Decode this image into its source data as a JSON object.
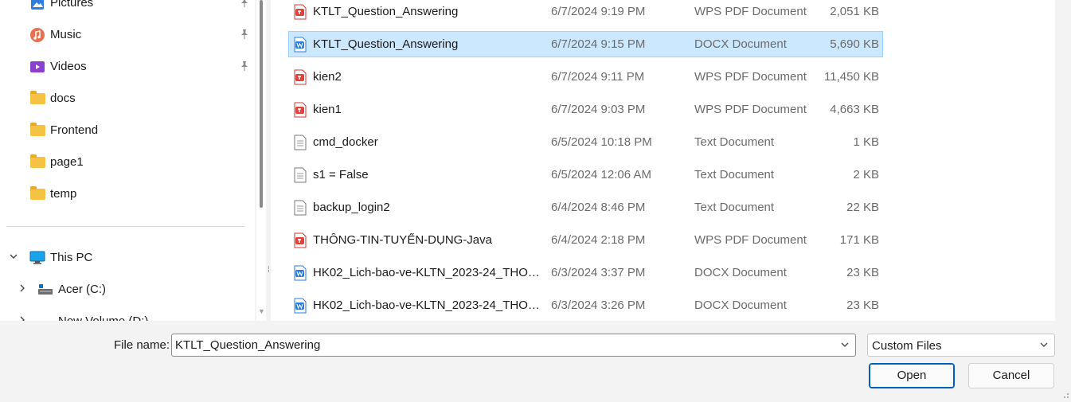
{
  "nav": {
    "quick_access": [
      {
        "label": "Pictures",
        "icon": "pictures-icon",
        "pinned": true
      },
      {
        "label": "Music",
        "icon": "music-icon",
        "pinned": true
      },
      {
        "label": "Videos",
        "icon": "videos-icon",
        "pinned": true
      },
      {
        "label": "docs",
        "icon": "folder-icon",
        "pinned": false
      },
      {
        "label": "Frontend",
        "icon": "folder-icon",
        "pinned": false
      },
      {
        "label": "page1",
        "icon": "folder-icon",
        "pinned": false
      },
      {
        "label": "temp",
        "icon": "folder-icon",
        "pinned": false
      }
    ],
    "this_pc": {
      "label": "This PC",
      "expanded": true
    },
    "drives": [
      {
        "label": "Acer (C:)"
      },
      {
        "label": "New Volume (D:)"
      }
    ]
  },
  "files": [
    {
      "name": "KTLT_Question_Answering",
      "date": "6/7/2024 9:19 PM",
      "type": "WPS PDF Document",
      "size": "2,051 KB",
      "kind": "pdf",
      "selected": false
    },
    {
      "name": "KTLT_Question_Answering",
      "date": "6/7/2024 9:15 PM",
      "type": "DOCX Document",
      "size": "5,690 KB",
      "kind": "docx",
      "selected": true
    },
    {
      "name": "kien2",
      "date": "6/7/2024 9:11 PM",
      "type": "WPS PDF Document",
      "size": "11,450 KB",
      "kind": "pdf",
      "selected": false
    },
    {
      "name": "kien1",
      "date": "6/7/2024 9:03 PM",
      "type": "WPS PDF Document",
      "size": "4,663 KB",
      "kind": "pdf",
      "selected": false
    },
    {
      "name": "cmd_docker",
      "date": "6/5/2024 10:18 PM",
      "type": "Text Document",
      "size": "1 KB",
      "kind": "txt",
      "selected": false
    },
    {
      "name": "s1 = False",
      "date": "6/5/2024 12:06 AM",
      "type": "Text Document",
      "size": "2 KB",
      "kind": "txt",
      "selected": false
    },
    {
      "name": "backup_login2",
      "date": "6/4/2024 8:46 PM",
      "type": "Text Document",
      "size": "22 KB",
      "kind": "txt",
      "selected": false
    },
    {
      "name": "THÔNG-TIN-TUYỂN-DỤNG-Java",
      "date": "6/4/2024 2:18 PM",
      "type": "WPS PDF Document",
      "size": "171 KB",
      "kind": "pdf",
      "selected": false
    },
    {
      "name": "HK02_Lich-bao-ve-KLTN_2023-24_THON...",
      "date": "6/3/2024 3:37 PM",
      "type": "DOCX Document",
      "size": "23 KB",
      "kind": "docx",
      "selected": false
    },
    {
      "name": "HK02_Lich-bao-ve-KLTN_2023-24_THON...",
      "date": "6/3/2024 3:26 PM",
      "type": "DOCX Document",
      "size": "23 KB",
      "kind": "docx",
      "selected": false
    }
  ],
  "footer": {
    "filename_label": "File name:",
    "filename_value": "KTLT_Question_Answering",
    "filetype_value": "Custom Files",
    "open_label": "Open",
    "cancel_label": "Cancel"
  },
  "colors": {
    "selection": "#cce8ff",
    "accent": "#005fb8",
    "pdf_icon": "#e2403a",
    "docx_icon": "#2a7be4",
    "folder": "#f6c244"
  }
}
